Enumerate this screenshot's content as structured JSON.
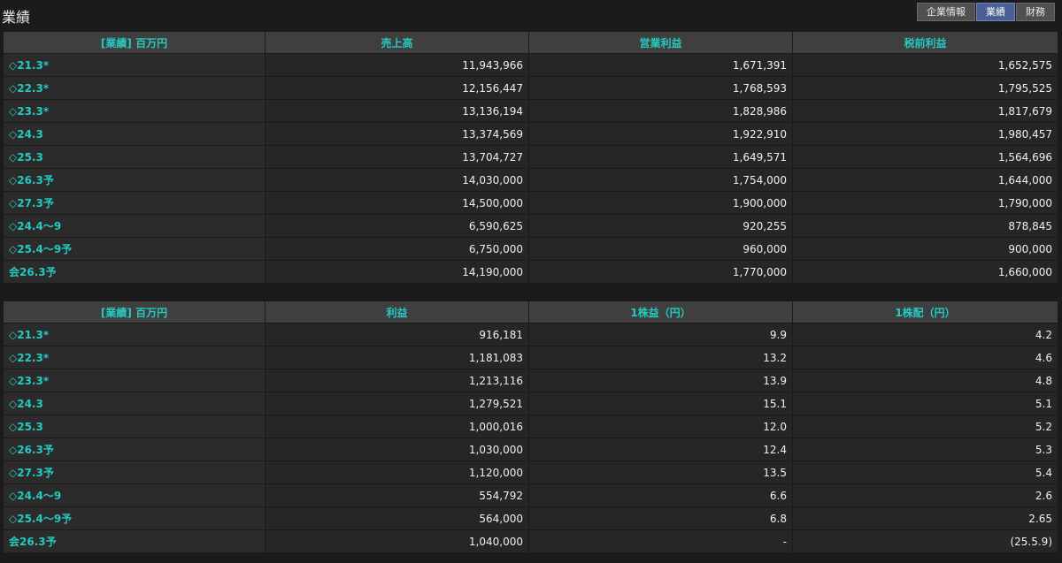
{
  "page": {
    "title": "業績"
  },
  "tabs": [
    {
      "label": "企業情報",
      "active": false
    },
    {
      "label": "業績",
      "active": true
    },
    {
      "label": "財務",
      "active": false
    }
  ],
  "colors": {
    "accent": "#25c9c0",
    "active_tab": "#4a5f93"
  },
  "table1": {
    "headers": [
      "[業績] 百万円",
      "売上高",
      "営業利益",
      "税前利益"
    ],
    "rows": [
      {
        "period": "◇21.3*",
        "values": [
          "11,943,966",
          "1,671,391",
          "1,652,575"
        ]
      },
      {
        "period": "◇22.3*",
        "values": [
          "12,156,447",
          "1,768,593",
          "1,795,525"
        ]
      },
      {
        "period": "◇23.3*",
        "values": [
          "13,136,194",
          "1,828,986",
          "1,817,679"
        ]
      },
      {
        "period": "◇24.3",
        "values": [
          "13,374,569",
          "1,922,910",
          "1,980,457"
        ]
      },
      {
        "period": "◇25.3",
        "values": [
          "13,704,727",
          "1,649,571",
          "1,564,696"
        ]
      },
      {
        "period": "◇26.3予",
        "values": [
          "14,030,000",
          "1,754,000",
          "1,644,000"
        ]
      },
      {
        "period": "◇27.3予",
        "values": [
          "14,500,000",
          "1,900,000",
          "1,790,000"
        ]
      },
      {
        "period": "◇24.4～9",
        "values": [
          "6,590,625",
          "920,255",
          "878,845"
        ]
      },
      {
        "period": "◇25.4～9予",
        "values": [
          "6,750,000",
          "960,000",
          "900,000"
        ]
      },
      {
        "period": "会26.3予",
        "values": [
          "14,190,000",
          "1,770,000",
          "1,660,000"
        ]
      }
    ]
  },
  "table2": {
    "headers": [
      "[業績] 百万円",
      "利益",
      "1株益（円）",
      "1株配（円）"
    ],
    "rows": [
      {
        "period": "◇21.3*",
        "values": [
          "916,181",
          "9.9",
          "4.2"
        ]
      },
      {
        "period": "◇22.3*",
        "values": [
          "1,181,083",
          "13.2",
          "4.6"
        ]
      },
      {
        "period": "◇23.3*",
        "values": [
          "1,213,116",
          "13.9",
          "4.8"
        ]
      },
      {
        "period": "◇24.3",
        "values": [
          "1,279,521",
          "15.1",
          "5.1"
        ]
      },
      {
        "period": "◇25.3",
        "values": [
          "1,000,016",
          "12.0",
          "5.2"
        ]
      },
      {
        "period": "◇26.3予",
        "values": [
          "1,030,000",
          "12.4",
          "5.3"
        ]
      },
      {
        "period": "◇27.3予",
        "values": [
          "1,120,000",
          "13.5",
          "5.4"
        ]
      },
      {
        "period": "◇24.4～9",
        "values": [
          "554,792",
          "6.6",
          "2.6"
        ]
      },
      {
        "period": "◇25.4～9予",
        "values": [
          "564,000",
          "6.8",
          "2.65"
        ]
      },
      {
        "period": "会26.3予",
        "values": [
          "1,040,000",
          "-",
          "(25.5.9)"
        ]
      }
    ]
  }
}
